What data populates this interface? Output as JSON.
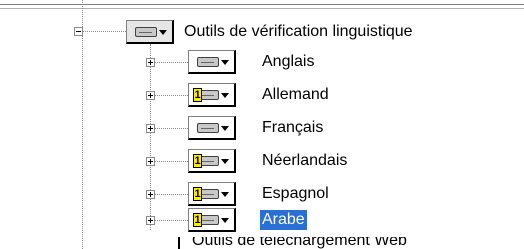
{
  "tree": {
    "parent": {
      "label": "Outils de vérification linguistique",
      "expanded": true,
      "install_icon": "hard-drive-icon"
    },
    "children": [
      {
        "label": "Anglais",
        "install_icon": "hard-drive-icon",
        "selected": false
      },
      {
        "label": "Allemand",
        "install_icon": "install-on-first-use-icon",
        "badge": "1",
        "selected": false
      },
      {
        "label": "Français",
        "install_icon": "hard-drive-icon",
        "selected": false
      },
      {
        "label": "Néerlandais",
        "install_icon": "install-on-first-use-icon",
        "badge": "1",
        "selected": false
      },
      {
        "label": "Espagnol",
        "install_icon": "install-on-first-use-icon",
        "badge": "1",
        "selected": false
      },
      {
        "label": "Arabe",
        "install_icon": "install-on-first-use-icon",
        "badge": "1",
        "selected": true
      }
    ],
    "cut_off_label": "Outils de téléchargement Web"
  },
  "colors": {
    "selection": "#2a6fd6",
    "badge": "#ffeb00"
  }
}
